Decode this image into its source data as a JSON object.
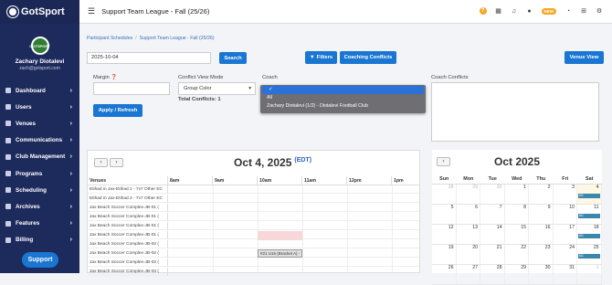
{
  "app": {
    "logo": "GotSport",
    "title": "Support Team League - Fall (25/26)"
  },
  "user": {
    "initials": "GOTSPORT",
    "name": "Zachary Diotalevi",
    "email": "zach@gotsport.com"
  },
  "nav": [
    {
      "label": "Dashboard"
    },
    {
      "label": "Users"
    },
    {
      "label": "Venues"
    },
    {
      "label": "Communications"
    },
    {
      "label": "Club Management"
    },
    {
      "label": "Programs"
    },
    {
      "label": "Scheduling"
    },
    {
      "label": "Archives"
    },
    {
      "label": "Features"
    },
    {
      "label": "Billing"
    }
  ],
  "support_label": "Support",
  "topbar": {
    "new_badge": "NEW"
  },
  "breadcrumb": {
    "first": "Participant Schedules",
    "second": "Support Team League - Fall (25/26)"
  },
  "toolbar": {
    "date_value": "2025-10-04",
    "search": "Search",
    "filters": "Filters",
    "coaching_conflicts": "Coaching Conflicts",
    "venue_view": "Venue View"
  },
  "form": {
    "margin_label": "Margin",
    "conflict_label": "Conflict View Mode",
    "conflict_value": "Group Color",
    "total_conflicts": "Total Conflicts: 1",
    "coach_label": "Coach",
    "coach_conflicts_label": "Coach Conflicts",
    "apply": "Apply / Refresh"
  },
  "coach_options": [
    {
      "label": ""
    },
    {
      "label": "All"
    },
    {
      "label": "Zachary Diotalevi (1/2) - Diotalevi Football Club"
    }
  ],
  "day": {
    "title": "Oct 4, 2025",
    "tz": "(EDT)",
    "venues_header": "Venues",
    "hours": [
      "8am",
      "9am",
      "10am",
      "11am",
      "12pm",
      "1pm"
    ],
    "venues": [
      "Etihad in Jax-Etihad 1 - 7v7 Other EC",
      "Etihad in Jax-Etihad 2 - 7v7 Other EC",
      "Jax Beach Soccer Complex-JB-01 (",
      "Jax Beach Soccer Complex-JB-01 (",
      "Jax Beach Soccer Complex-JB-01 (",
      "Jax Beach Soccer Complex-JB-01 (",
      "Jax Beach Soccer Complex-JB-02 (",
      "Jax Beach Soccer Complex-JB-02 (",
      "Jax Beach Soccer Complex-JB-02 (",
      "Jax Beach Soccer Complex-JB-03 ("
    ],
    "event": "#21 U15 (Bracket A) -"
  },
  "month": {
    "title": "Oct 2025",
    "days": [
      "Sun",
      "Mon",
      "Tue",
      "Wed",
      "Thu",
      "Fri",
      "Sat"
    ],
    "weeks": [
      [
        "28",
        "29",
        "30",
        "1",
        "2",
        "3",
        "4"
      ],
      [
        "5",
        "6",
        "7",
        "8",
        "9",
        "10",
        "11"
      ],
      [
        "12",
        "13",
        "14",
        "15",
        "16",
        "17",
        "18"
      ],
      [
        "19",
        "20",
        "21",
        "22",
        "23",
        "24",
        "25"
      ],
      [
        "26",
        "27",
        "28",
        "29",
        "30",
        "31",
        "1"
      ]
    ],
    "event_label": "6/1"
  }
}
